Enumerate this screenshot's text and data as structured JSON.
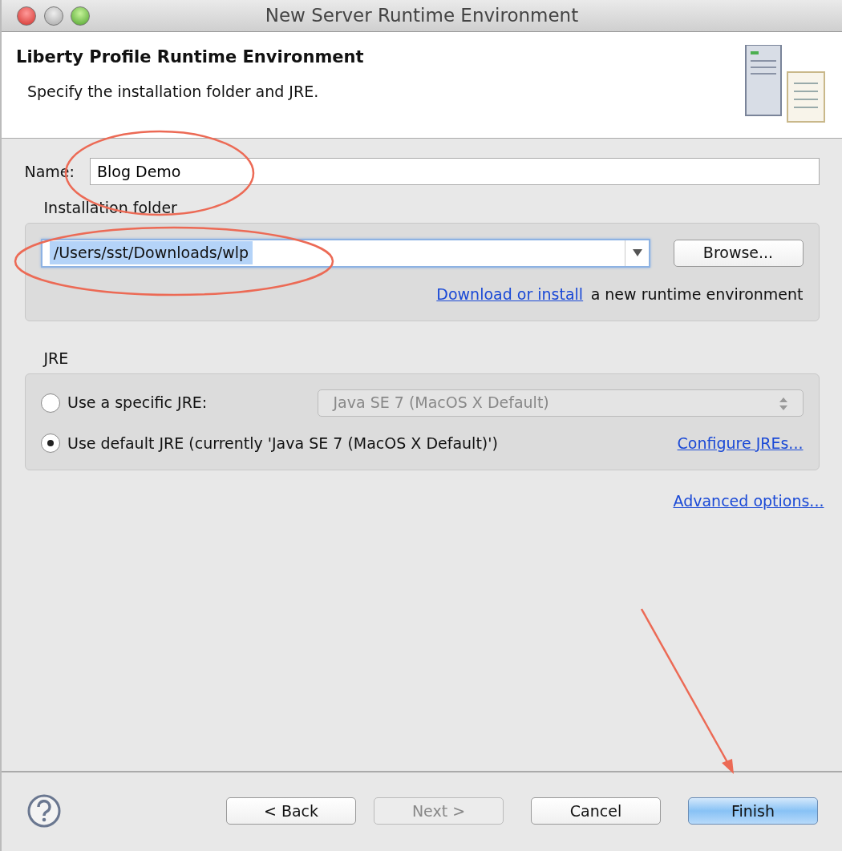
{
  "window": {
    "title": "New Server Runtime Environment"
  },
  "header": {
    "title": "Liberty Profile Runtime Environment",
    "description": "Specify the installation folder and JRE."
  },
  "name_field": {
    "label": "Name:",
    "value": "Blog Demo",
    "circled": true
  },
  "installation_folder": {
    "title": "Installation folder",
    "path": "/Users/sst/Downloads/wlp",
    "selected": true,
    "circled": true,
    "browse": "Browse...",
    "link": "Download or install",
    "link_suffix": "a new runtime environment"
  },
  "jre": {
    "title": "JRE",
    "options": [
      {
        "kind": "select",
        "label": "Use a specific JRE:",
        "selected": false,
        "value": "Java SE 7 (MacOS X Default)",
        "disabled": true
      },
      {
        "kind": "link",
        "label": "Use default JRE (currently 'Java SE 7 (MacOS X Default)')",
        "selected": true,
        "link": "Configure JREs..."
      }
    ]
  },
  "advanced_link": "Advanced options...",
  "buttons": [
    {
      "label": "< Back",
      "disabled": false,
      "default": false,
      "pointed_at": false
    },
    {
      "label": "Next >",
      "disabled": true,
      "default": false,
      "pointed_at": false
    },
    {
      "label": "Cancel",
      "disabled": false,
      "default": false,
      "pointed_at": false
    },
    {
      "label": "Finish",
      "disabled": false,
      "default": true,
      "pointed_at": true
    }
  ]
}
